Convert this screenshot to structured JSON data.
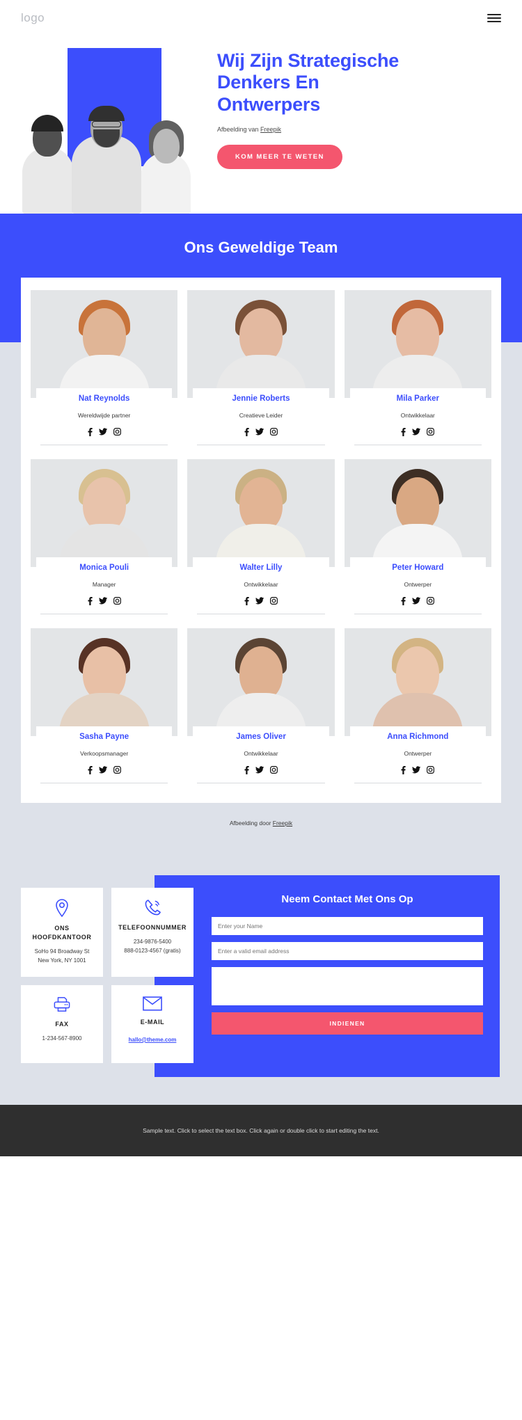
{
  "header": {
    "logo": "logo",
    "menu_icon": "hamburger-icon"
  },
  "hero": {
    "title": "Wij Zijn Strategische Denkers En Ontwerpers",
    "credit_prefix": "Afbeelding van ",
    "credit_link": "Freepik",
    "cta_label": "KOM MEER TE WETEN"
  },
  "team": {
    "heading": "Ons Geweldige Team",
    "credit_prefix": "Afbeelding door ",
    "credit_link": "Freepik",
    "members": [
      {
        "name": "Nat Reynolds",
        "role": "Wereldwijde partner",
        "skin": "#e0b596",
        "hair": "#c8733a",
        "torso": "#f2f2f2"
      },
      {
        "name": "Jennie Roberts",
        "role": "Creatieve Leider",
        "skin": "#e3b9a0",
        "hair": "#7a5138",
        "torso": "#e9e9e9"
      },
      {
        "name": "Mila Parker",
        "role": "Ontwikkelaar",
        "skin": "#e6bca4",
        "hair": "#c1673a",
        "torso": "#ededed"
      },
      {
        "name": "Monica Pouli",
        "role": "Manager",
        "skin": "#e8c3ab",
        "hair": "#d8c091",
        "torso": "#e4e4e4"
      },
      {
        "name": "Walter Lilly",
        "role": "Ontwikkelaar",
        "skin": "#e2b494",
        "hair": "#cbb184",
        "torso": "#f0efe9"
      },
      {
        "name": "Peter Howard",
        "role": "Ontwerper",
        "skin": "#d9a883",
        "hair": "#3d2e24",
        "torso": "#f4f4f4"
      },
      {
        "name": "Sasha Payne",
        "role": "Verkoopsmanager",
        "skin": "#e8c0a6",
        "hair": "#573225",
        "torso": "#e3d3c4"
      },
      {
        "name": "James Oliver",
        "role": "Ontwikkelaar",
        "skin": "#dfb191",
        "hair": "#5b4434",
        "torso": "#eeeeee"
      },
      {
        "name": "Anna Richmond",
        "role": "Ontwerper",
        "skin": "#ebc7ad",
        "hair": "#d3b483",
        "torso": "#dfc1ae"
      }
    ],
    "social_icons": [
      "facebook-icon",
      "twitter-icon",
      "instagram-icon"
    ]
  },
  "contact": {
    "cards": [
      {
        "icon": "location-pin-icon",
        "title": "ONS HOOFDKANTOOR",
        "lines": [
          "SoHo 94 Broadway St",
          "New York, NY 1001"
        ],
        "link": ""
      },
      {
        "icon": "phone-icon",
        "title": "TELEFOONNUMMER",
        "lines": [
          "234-9876-5400",
          "888-0123-4567 (gratis)"
        ],
        "link": ""
      },
      {
        "icon": "printer-icon",
        "title": "FAX",
        "lines": [
          "1-234-567-8900"
        ],
        "link": ""
      },
      {
        "icon": "envelope-icon",
        "title": "E-MAIL",
        "lines": [],
        "link": "hallo@theme.com"
      }
    ],
    "form": {
      "title": "Neem Contact Met Ons Op",
      "name_placeholder": "Enter your Name",
      "email_placeholder": "Enter a valid email address",
      "message_placeholder": "",
      "submit_label": "INDIENEN"
    }
  },
  "footer": {
    "text": "Sample text. Click to select the text box. Click again or double click to start editing the text."
  },
  "colors": {
    "brand_blue": "#3c4efc",
    "accent_pink": "#f4566e",
    "page_gray": "#dde1e9",
    "footer_dark": "#2f2f2f"
  }
}
